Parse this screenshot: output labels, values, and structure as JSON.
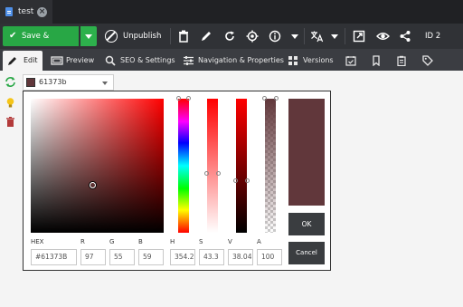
{
  "tab": {
    "title": "test",
    "close_glyph": "×",
    "icon": "document-icon"
  },
  "toolbar": {
    "save_label": "Save & Publish",
    "save_check": "✔",
    "unpublish_label": "Unpublish",
    "id_label": "ID 2",
    "icons": [
      "trash-icon",
      "pencil-icon",
      "refresh-icon",
      "target-icon",
      "info-icon",
      "translate-icon",
      "external-link-icon",
      "eye-icon",
      "share-icon"
    ]
  },
  "nav": {
    "tabs": [
      {
        "label": "Edit",
        "icon": "pencil-icon"
      },
      {
        "label": "Preview",
        "icon": "preview-icon"
      },
      {
        "label": "SEO & Settings",
        "icon": "search-icon"
      },
      {
        "label": "Navigation & Properties",
        "icon": "sliders-icon"
      },
      {
        "label": "Versions",
        "icon": "grid-icon"
      }
    ],
    "extra_icons": [
      "calendar-check-icon",
      "bookmark-icon",
      "clipboard-icon",
      "tag-icon"
    ]
  },
  "sidebar": {
    "icons": [
      "sync-icon",
      "lightbulb-icon",
      "trash-icon"
    ]
  },
  "color_select": {
    "value": "61373b",
    "swatch_color": "#61373b"
  },
  "picker": {
    "current_color": "#61373b",
    "hue_color": "#ff0000",
    "ok_label": "OK",
    "cancel_label": "Cancel",
    "labels": {
      "hex": "HEX",
      "r": "R",
      "g": "G",
      "b": "B",
      "h": "H",
      "s": "S",
      "v": "V",
      "a": "A"
    },
    "values": {
      "hex": "#61373B",
      "r": "97",
      "g": "55",
      "b": "59",
      "h": "354.2",
      "s": "43.3",
      "v": "38.04",
      "a": "100"
    }
  },
  "colors": {
    "save_green": "#28a745",
    "toolbar_bg": "#303236",
    "nav_bg": "#3b3d42",
    "tabstrip_bg": "#202124"
  }
}
